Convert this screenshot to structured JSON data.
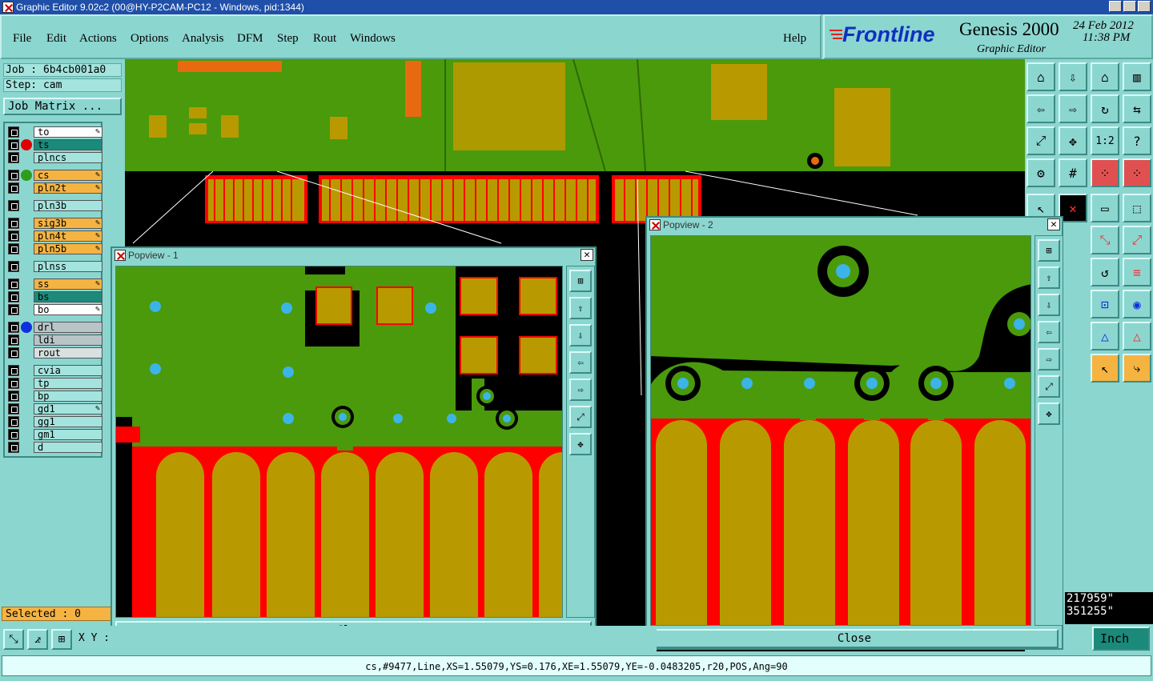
{
  "window": {
    "title": "Graphic Editor 9.02c2 (00@HY-P2CAM-PC12 - Windows, pid:1344)"
  },
  "menu": [
    "File",
    "Edit",
    "Actions",
    "Options",
    "Analysis",
    "DFM",
    "Step",
    "Rout",
    "Windows"
  ],
  "help": "Help",
  "brand": {
    "logo": "Frontline",
    "product": "Genesis 2000",
    "subtitle": "Graphic Editor",
    "date": "24 Feb 2012",
    "time": "11:38 PM"
  },
  "job": {
    "job_label": "Job : 6b4cb001a0",
    "step_label": "Step: cam",
    "matrix_button": "Job Matrix ..."
  },
  "layers": [
    {
      "name": "to",
      "bg": "#ffffff",
      "edit": true
    },
    {
      "name": "ts",
      "bg": "#1b8a7a",
      "dot": "#e00000",
      "edit": false
    },
    {
      "name": "plncs",
      "bg": "#a4e4de"
    },
    {
      "name": "cs",
      "bg": "#f5b342",
      "dot": "#2e9c1c",
      "edit": true
    },
    {
      "name": "pln2t",
      "bg": "#f5b342",
      "edit": true
    },
    {
      "name": "pln3b",
      "bg": "#a4e4de"
    },
    {
      "name": "sig3b",
      "bg": "#f5b342",
      "edit": true
    },
    {
      "name": "pln4t",
      "bg": "#f5b342",
      "edit": true
    },
    {
      "name": "pln5b",
      "bg": "#f5b342",
      "edit": true
    },
    {
      "name": "plnss",
      "bg": "#a4e4de"
    },
    {
      "name": "ss",
      "bg": "#f5b342",
      "edit": true
    },
    {
      "name": "bs",
      "bg": "#1b8a7a"
    },
    {
      "name": "bo",
      "bg": "#ffffff",
      "edit": true
    },
    {
      "name": "drl",
      "bg": "#b8c4c8",
      "dot": "#1030e0"
    },
    {
      "name": "ldi",
      "bg": "#b8c4c8"
    },
    {
      "name": "rout",
      "bg": "#d8e0e0"
    },
    {
      "name": "cvia",
      "bg": "#a4e4de"
    },
    {
      "name": "tp",
      "bg": "#a4e4de"
    },
    {
      "name": "bp",
      "bg": "#a4e4de"
    },
    {
      "name": "gd1",
      "bg": "#a4e4de",
      "edit": true
    },
    {
      "name": "gg1",
      "bg": "#a4e4de"
    },
    {
      "name": "gm1",
      "bg": "#a4e4de"
    },
    {
      "name": "d",
      "bg": "#a4e4de"
    }
  ],
  "selected": "Selected : 0",
  "popview1": {
    "title": "Popview - 1",
    "close": "Close"
  },
  "popview2": {
    "title": "Popview - 2",
    "close": "Close"
  },
  "coords": {
    "xy_label": "X Y :",
    "x": "217959\"",
    "y": "351255\""
  },
  "units": "Inch",
  "status": "cs,#9477,Line,XS=1.55079,YS=0.176,XE=1.55079,YE=-0.0483205,r20,POS,Ang=90",
  "colors": {
    "board": "#4a9a0c",
    "copper": "#b89a00",
    "soldermask": "#ff0000",
    "via": "#3cb4e8",
    "ui": "#8cd6d0"
  }
}
